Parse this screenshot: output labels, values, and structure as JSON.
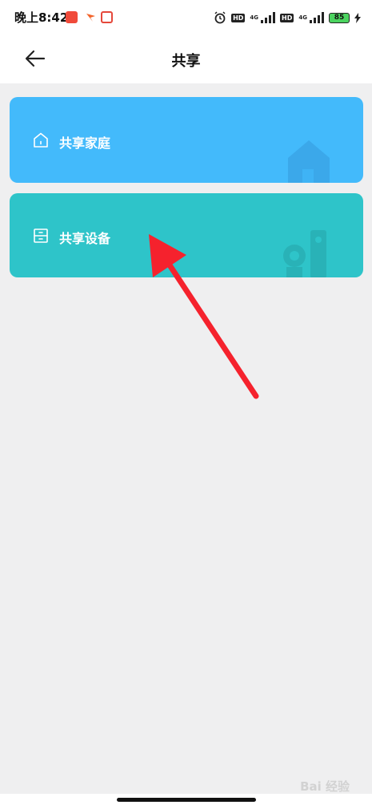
{
  "status_bar": {
    "time": "晚上8:42",
    "hd_label": "HD",
    "network_label": "4G",
    "battery_level": "85",
    "icons": [
      "app-notification-icon",
      "app-flag-icon",
      "app-gift-icon",
      "alarm-icon",
      "signal-icon",
      "battery-icon",
      "charging-icon"
    ]
  },
  "header": {
    "title": "共享",
    "back_icon": "arrow-left-icon"
  },
  "cards": [
    {
      "label": "共享家庭",
      "icon": "home-outline-icon",
      "color": "#43bafb"
    },
    {
      "label": "共享设备",
      "icon": "device-cabinet-icon",
      "color": "#2ec4c9"
    }
  ],
  "annotation": {
    "arrow_color": "#f5222d"
  },
  "watermark": {
    "text": "Bai 经验"
  }
}
